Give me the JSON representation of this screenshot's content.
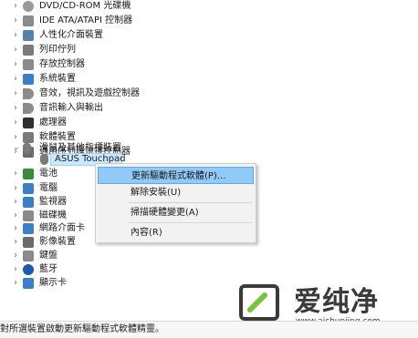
{
  "tree": {
    "items": [
      {
        "label": "DVD/CD-ROM 光碟機",
        "icon": "dvd-drive-icon",
        "color": "#7a7a7a"
      },
      {
        "label": "IDE ATA/ATAPI 控制器",
        "icon": "ide-controller-icon",
        "color": "#6f6f6f"
      },
      {
        "label": "人性化介面裝置",
        "icon": "hid-icon",
        "color": "#5a7fa8"
      },
      {
        "label": "列印佇列",
        "icon": "printer-icon",
        "color": "#6e6e6e"
      },
      {
        "label": "存放控制器",
        "icon": "storage-controller-icon",
        "color": "#6e6e6e"
      },
      {
        "label": "系統裝置",
        "icon": "system-device-icon",
        "color": "#3e7fc4"
      },
      {
        "label": "音效，視訊及遊戲控制器",
        "icon": "sound-icon",
        "color": "#7b7b7b"
      },
      {
        "label": "音訊輸入與輸出",
        "icon": "audio-io-icon",
        "color": "#7b7b7b"
      },
      {
        "label": "處理器",
        "icon": "processor-icon",
        "color": "#3a3a3a"
      },
      {
        "label": "軟體裝置",
        "icon": "software-device-icon",
        "color": "#6a6a6a"
      },
      {
        "label": "通用序列匯流排控制器",
        "icon": "usb-icon",
        "color": "#5a5a5a"
      },
      {
        "label": "滑鼠及其他指標裝置",
        "icon": "mouse-icon",
        "color": "#6a6a6a"
      },
      {
        "label": "ASUS Touchpad",
        "icon": "mouse-icon",
        "color": "#6a6a6a"
      },
      {
        "label": "電池",
        "icon": "battery-icon",
        "color": "#3f8a3a"
      },
      {
        "label": "電腦",
        "icon": "computer-icon",
        "color": "#3e7fc4"
      },
      {
        "label": "監視器",
        "icon": "monitor-icon",
        "color": "#3e7fc4"
      },
      {
        "label": "磁碟機",
        "icon": "disk-drive-icon",
        "color": "#7a7a7a"
      },
      {
        "label": "網路介面卡",
        "icon": "network-adapter-icon",
        "color": "#3e7fc4"
      },
      {
        "label": "影像裝置",
        "icon": "camera-icon",
        "color": "#6a6a6a"
      },
      {
        "label": "鍵盤",
        "icon": "keyboard-icon",
        "color": "#7a7a7a"
      },
      {
        "label": "藍牙",
        "icon": "bluetooth-icon",
        "color": "#1f5aa8"
      },
      {
        "label": "顯示卡",
        "icon": "display-adapter-icon",
        "color": "#3e7fc4"
      }
    ]
  },
  "context_menu": {
    "items": [
      {
        "label": "更新驅動程式軟體(P)..."
      },
      {
        "label": "解除安裝(U)"
      },
      {
        "label": "掃描硬體變更(A)"
      },
      {
        "label": "內容(R)"
      }
    ]
  },
  "status_bar": {
    "text": "對所選裝置啟動更新驅動程式軟體精靈。"
  },
  "watermark": {
    "text": "爱纯净",
    "url": "www.aichunjing.com"
  }
}
